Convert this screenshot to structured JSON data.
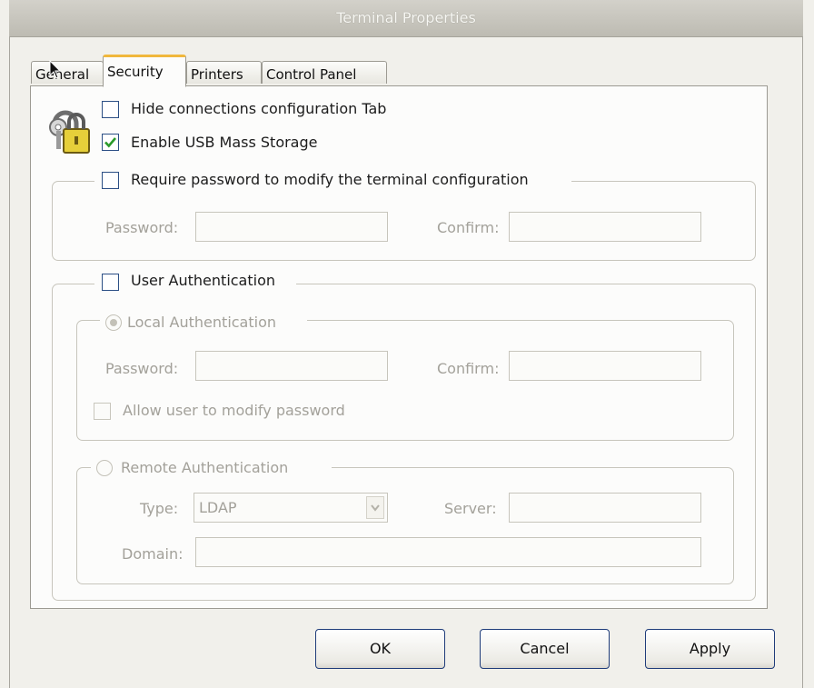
{
  "window": {
    "title": "Terminal Properties"
  },
  "tabs": [
    {
      "label": "General",
      "active": false
    },
    {
      "label": "Security",
      "active": true
    },
    {
      "label": "Printers",
      "active": false
    },
    {
      "label": "Control Panel",
      "active": false
    }
  ],
  "security": {
    "hide_connections_tab": {
      "label": "Hide connections configuration Tab",
      "checked": false
    },
    "enable_usb": {
      "label": "Enable USB Mass Storage",
      "checked": true
    },
    "require_password": {
      "label": "Require password to modify the terminal configuration",
      "checked": false,
      "password_label": "Password:",
      "password_value": "",
      "confirm_label": "Confirm:",
      "confirm_value": ""
    },
    "user_auth": {
      "label": "User Authentication",
      "checked": false,
      "local": {
        "label": "Local Authentication",
        "selected": true,
        "password_label": "Password:",
        "confirm_label": "Confirm:",
        "allow_modify_label": "Allow user to modify password",
        "allow_modify_checked": false
      },
      "remote": {
        "label": "Remote Authentication",
        "selected": false,
        "type_label": "Type:",
        "type_value": "LDAP",
        "server_label": "Server:",
        "server_value": "",
        "domain_label": "Domain:",
        "domain_value": ""
      }
    }
  },
  "buttons": {
    "ok": "OK",
    "cancel": "Cancel",
    "apply": "Apply"
  },
  "icons": {
    "lock": "lock-icon",
    "check": "checkmark-icon",
    "cursor": "mouse-cursor-icon"
  },
  "colors": {
    "accent_tab": "#f0b73c",
    "checkbox_border": "#2c4f85",
    "check_mark": "#2a9a2a"
  }
}
